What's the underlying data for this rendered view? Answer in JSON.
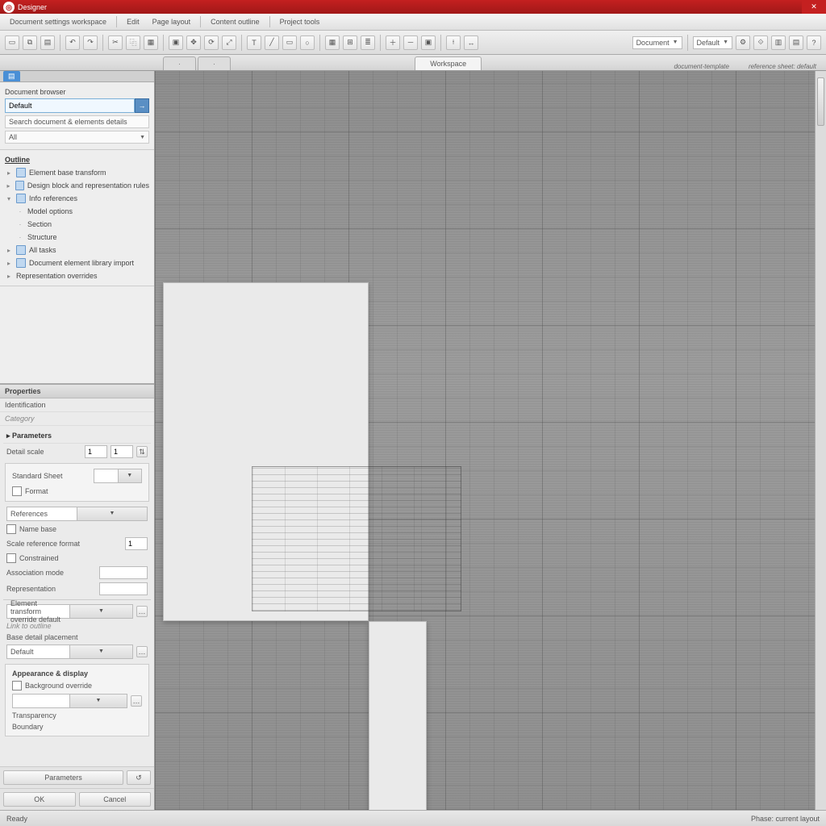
{
  "title": {
    "app_name": "Designer"
  },
  "menu": {
    "items": [
      "Document settings workspace",
      "Edit",
      "Page layout",
      "Content outline",
      "Project tools"
    ]
  },
  "toolbar": {
    "combo1": "Document",
    "combo2": "Default"
  },
  "tabs": {
    "active": "Workspace",
    "info1": "document-template",
    "info2": "reference sheet: default"
  },
  "browser": {
    "section_label": "Document browser",
    "current": "Default",
    "filter_label": "Search document & elements details",
    "filter_value": "All",
    "outline_hdr": "Outline",
    "items": [
      "Element base transform",
      "Design block and representation rules",
      "Info references",
      "Model options",
      "Section",
      "Structure",
      "All tasks",
      "Document element library import",
      "Representation overrides"
    ]
  },
  "properties": {
    "panel_title": "Properties",
    "identity_label": "Identification",
    "category_label": "Category",
    "group_hdr": "Parameters",
    "scale_label": "Detail scale",
    "scale_val1": "1",
    "scale_val2": "1",
    "standard_label": "Standard Sheet",
    "format_label": "Format",
    "wherefrom_label": "References",
    "name_label": "Name base",
    "size_label": "Scale reference format",
    "size_val": "1",
    "constrained_label": "Constrained",
    "assoc1_label": "Association mode",
    "assoc2_label": "Representation",
    "transform_label": "Element transform override default",
    "link_label": "Link to outline",
    "detail_label": "Base detail placement",
    "detail_field": "Default",
    "advanced_hdr": "Appearance & display",
    "adv_item1": "Background override",
    "adv_item2": "Transparency",
    "adv_item3": "Boundary",
    "btn_apply": "Parameters",
    "btn_reset": "Reset",
    "btn_ok": "OK",
    "btn_cancel": "Cancel"
  },
  "status": {
    "left": "Ready",
    "mid": "Phase: current layout"
  }
}
